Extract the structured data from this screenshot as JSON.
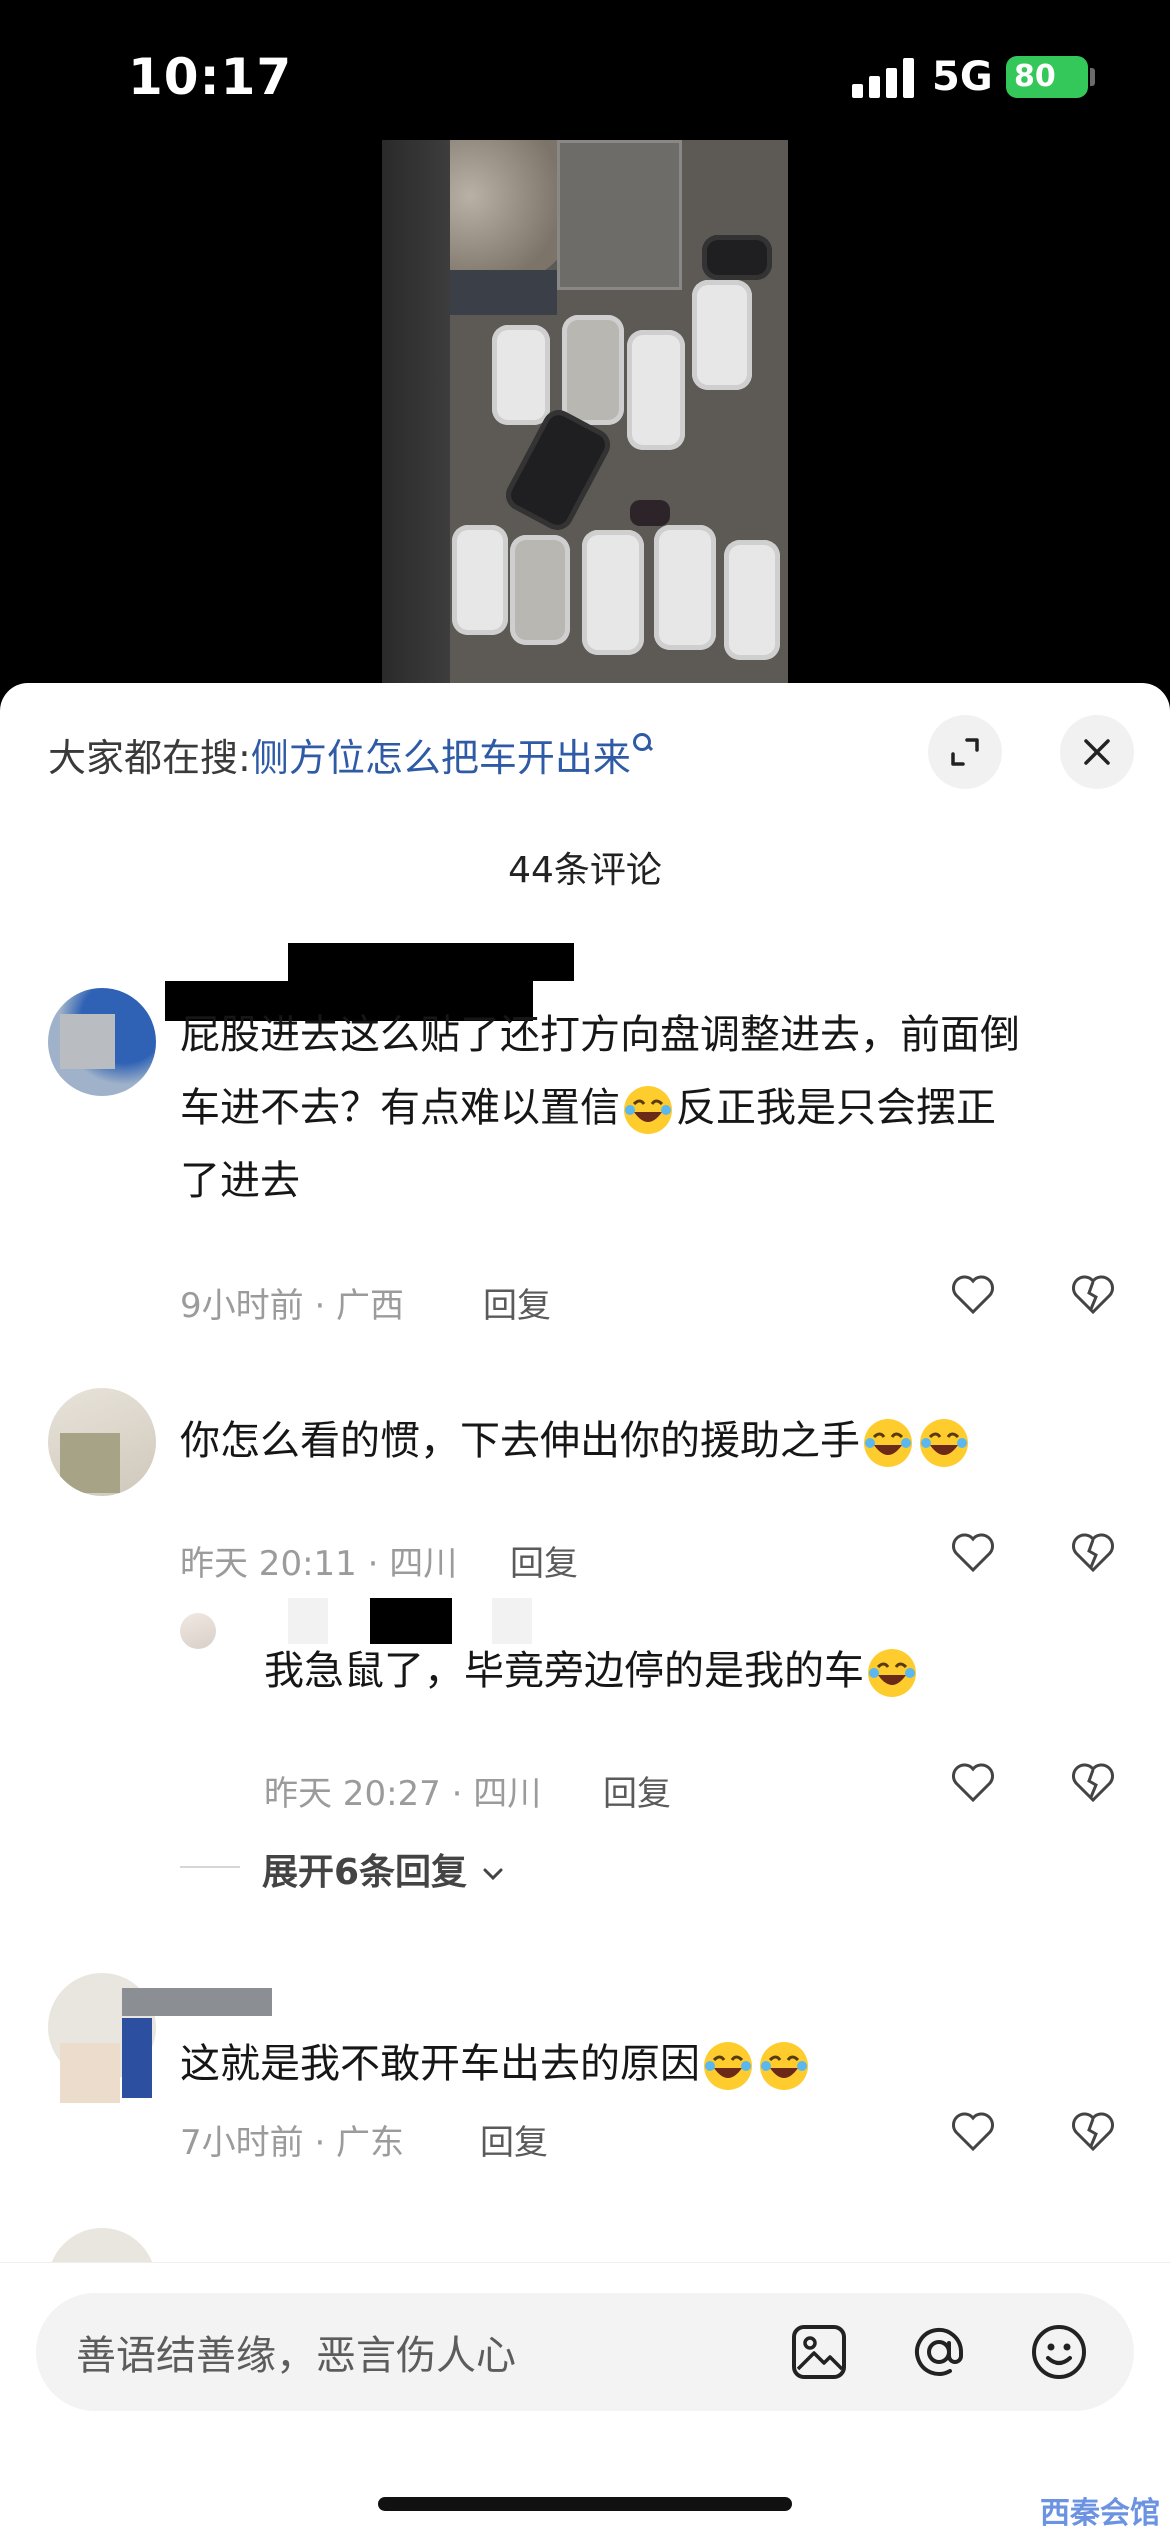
{
  "status": {
    "time": "10:17",
    "network": "5G",
    "battery": "80"
  },
  "sheet": {
    "search_prefix": "大家都在搜:",
    "search_query": "侧方位怎么把车开出来",
    "comment_count": "44条评论"
  },
  "comments": [
    {
      "lines": [
        "屁股进去这么贴了还打方向盘调整进去，前面倒",
        "车进不去？有点难以置信",
        "反正我是只会摆正",
        "了进去"
      ],
      "meta": "9小时前 · 广西",
      "reply": "回复"
    },
    {
      "text": "你怎么看的惯，下去伸出你的援助之手",
      "meta": "昨天 20:11 · 四川",
      "reply": "回复"
    },
    {
      "text": "我急鼠了，毕竟旁边停的是我的车",
      "meta": "昨天 20:27 · 四川",
      "reply": "回复"
    },
    {
      "text": "这就是我不敢开车出去的原因",
      "meta": "7小时前 · 广东",
      "reply": "回复"
    }
  ],
  "expand_replies": "展开6条回复",
  "input": {
    "placeholder": "善语结善缘，恶言伤人心"
  },
  "icons": [
    "search-icon",
    "expand-icon",
    "close-icon",
    "heart-icon",
    "broken-heart-icon",
    "image-icon",
    "at-icon",
    "emoji-icon",
    "chevron-down-icon"
  ],
  "watermark": "西秦会馆"
}
